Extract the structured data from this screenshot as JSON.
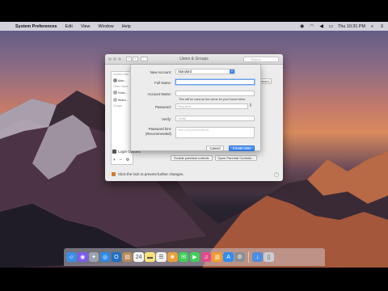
{
  "menubar": {
    "app_name": "System Preferences",
    "items": [
      "Edit",
      "View",
      "Window",
      "Help"
    ],
    "clock": "Thu 10:31 PM"
  },
  "sysprefs": {
    "window_title": "Users & Groups",
    "search_placeholder": "Search",
    "sidebar": {
      "current_user_heading": "Current User",
      "other_users_heading": "Other Users",
      "rows": [
        "Adm...",
        "Gues...",
        "Share..."
      ],
      "groups_heading": "Groups",
      "login_options": "Login Options"
    },
    "right_button": "Password...",
    "bottom_buttons": [
      "Enable parental controls",
      "Open Parental Controls..."
    ],
    "lock_text": "Click the lock to prevent further changes.",
    "help": "?"
  },
  "sheet": {
    "new_account_label": "New Account:",
    "new_account_value": "Standard",
    "full_name_label": "Full Name:",
    "full_name_value": "",
    "account_name_label": "Account Name:",
    "account_name_value": "",
    "account_name_hint": "This will be used as the name for your home folder.",
    "password_label": "Password:",
    "password_placeholder": "Required",
    "verify_label": "Verify:",
    "verify_placeholder": "Verify",
    "hint_label_1": "Password hint:",
    "hint_label_2": "(Recommended)",
    "hint_placeholder": "Hint (Recommended)",
    "cancel": "Cancel",
    "create": "Create User"
  },
  "dock": {
    "icons": [
      "finder-icon",
      "siri-icon",
      "launchpad-icon",
      "safari-icon",
      "outlook-icon",
      "contacts-icon",
      "calendar-icon",
      "notes-icon",
      "reminders-icon",
      "photos-icon",
      "messages-icon",
      "facetime-icon",
      "itunes-icon",
      "ibooks-icon",
      "app-store-icon",
      "system-preferences-icon",
      "downloads-icon",
      "trash-icon"
    ],
    "colors": [
      "#3a8ee6",
      "#7b5cf0",
      "#9aa3ad",
      "#2e89e8",
      "#1f6fc4",
      "#b58a5a",
      "#f4f4f4",
      "#f7e27a",
      "#f1f1f1",
      "#e9a03b",
      "#3fcf5a",
      "#3fcf5a",
      "#e24b8a",
      "#f29b2d",
      "#2f8df0",
      "#8a8f96",
      "#4c8ee0",
      "#c9ccd1"
    ]
  }
}
